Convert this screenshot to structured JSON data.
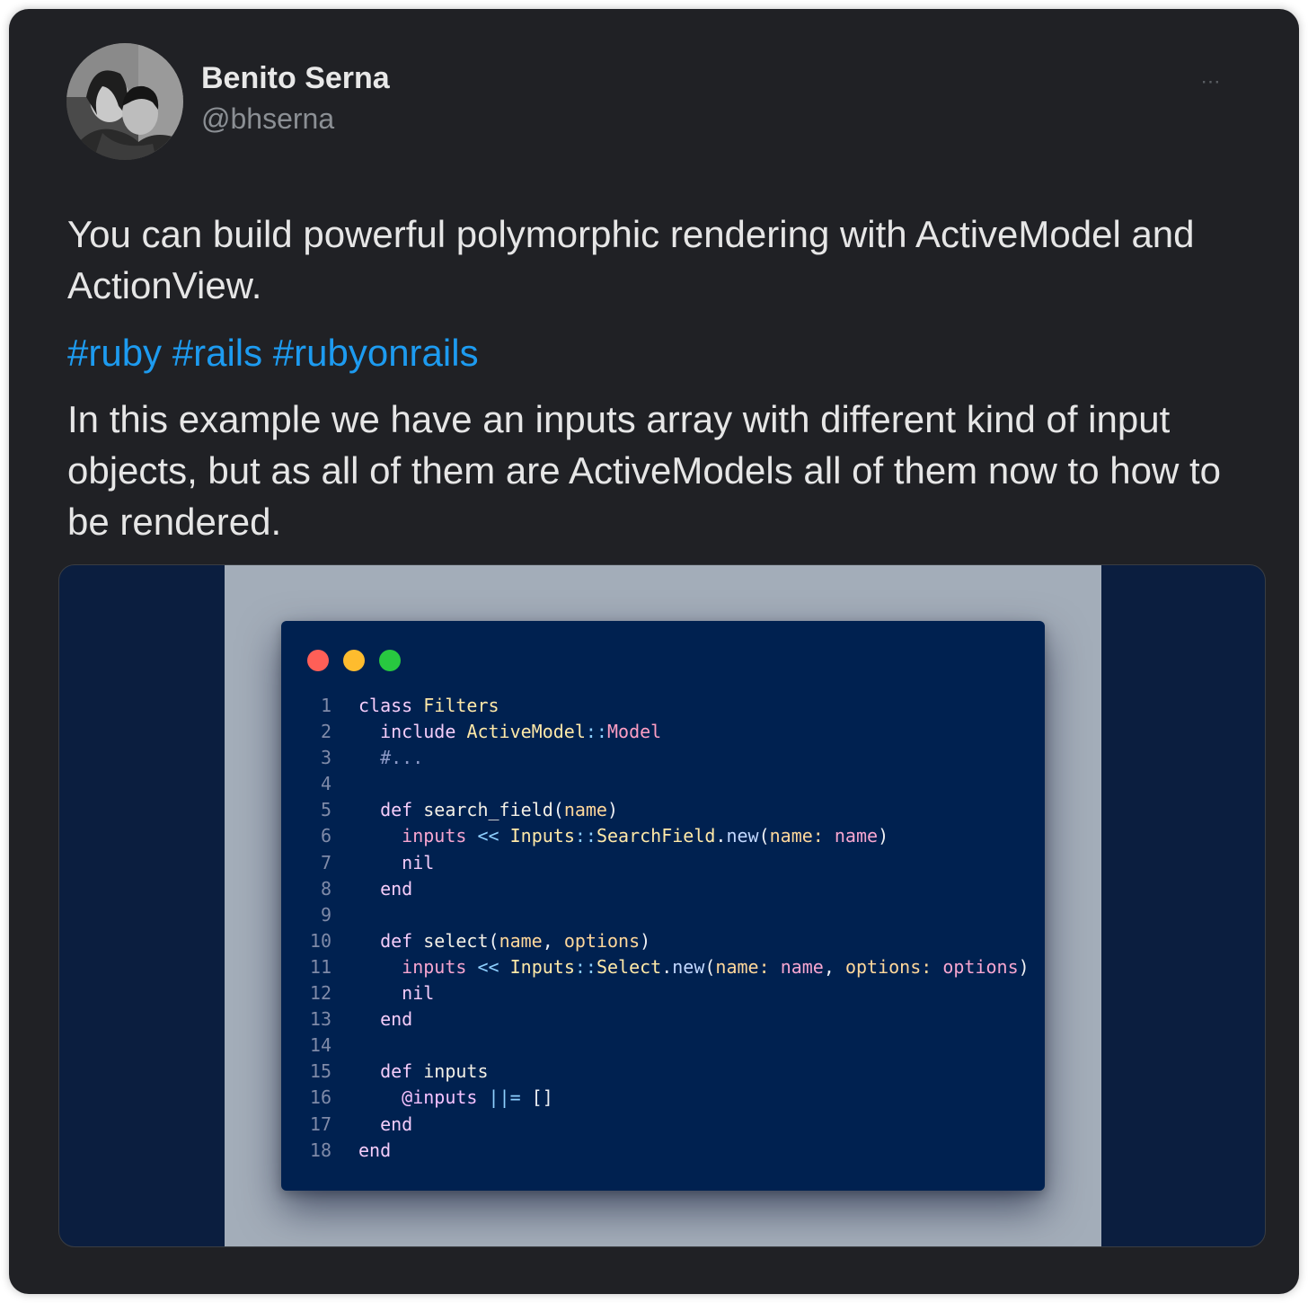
{
  "author": {
    "name": "Benito Serna",
    "handle": "@bhserna",
    "avatar_icon": "profile-photo"
  },
  "more_icon": "⋯",
  "tweet": {
    "paragraph1": "You can build powerful polymorphic rendering with ActiveModel and ActionView.",
    "hashtags": [
      "#ruby",
      "#rails",
      "#rubyonrails"
    ],
    "paragraph3": "In this example we have an inputs array with different kind of input objects, but as all of them are ActiveModels all of them now to how to be rendered."
  },
  "code": {
    "line_numbers": [
      "1",
      "2",
      "3",
      "4",
      "5",
      "6",
      "7",
      "8",
      "9",
      "10",
      "11",
      "12",
      "13",
      "14",
      "15",
      "16",
      "17",
      "18"
    ],
    "lines": [
      [
        [
          "kw",
          "class"
        ],
        [
          "p",
          " "
        ],
        [
          "cls",
          "Filters"
        ]
      ],
      [
        [
          "p",
          "  "
        ],
        [
          "kw",
          "include"
        ],
        [
          "p",
          " "
        ],
        [
          "cls",
          "ActiveModel"
        ],
        [
          "op",
          "::"
        ],
        [
          "mod",
          "Model"
        ]
      ],
      [
        [
          "p",
          "  "
        ],
        [
          "cm",
          "#..."
        ]
      ],
      [],
      [
        [
          "p",
          "  "
        ],
        [
          "kw",
          "def"
        ],
        [
          "p",
          " "
        ],
        [
          "def",
          "search_field"
        ],
        [
          "p",
          "("
        ],
        [
          "sym",
          "name"
        ],
        [
          "p",
          ")"
        ]
      ],
      [
        [
          "p",
          "    "
        ],
        [
          "var",
          "inputs"
        ],
        [
          "p",
          " "
        ],
        [
          "op",
          "<<"
        ],
        [
          "p",
          " "
        ],
        [
          "cls",
          "Inputs"
        ],
        [
          "op",
          "::"
        ],
        [
          "cls",
          "SearchField"
        ],
        [
          "p",
          "."
        ],
        [
          "call",
          "new"
        ],
        [
          "p",
          "("
        ],
        [
          "sym",
          "name:"
        ],
        [
          "p",
          " "
        ],
        [
          "var",
          "name"
        ],
        [
          "p",
          ")"
        ]
      ],
      [
        [
          "p",
          "    "
        ],
        [
          "kw",
          "nil"
        ]
      ],
      [
        [
          "p",
          "  "
        ],
        [
          "kw",
          "end"
        ]
      ],
      [],
      [
        [
          "p",
          "  "
        ],
        [
          "kw",
          "def"
        ],
        [
          "p",
          " "
        ],
        [
          "def",
          "select"
        ],
        [
          "p",
          "("
        ],
        [
          "sym",
          "name"
        ],
        [
          "p",
          ", "
        ],
        [
          "sym",
          "options"
        ],
        [
          "p",
          ")"
        ]
      ],
      [
        [
          "p",
          "    "
        ],
        [
          "var",
          "inputs"
        ],
        [
          "p",
          " "
        ],
        [
          "op",
          "<<"
        ],
        [
          "p",
          " "
        ],
        [
          "cls",
          "Inputs"
        ],
        [
          "op",
          "::"
        ],
        [
          "cls",
          "Select"
        ],
        [
          "p",
          "."
        ],
        [
          "call",
          "new"
        ],
        [
          "p",
          "("
        ],
        [
          "sym",
          "name:"
        ],
        [
          "p",
          " "
        ],
        [
          "var",
          "name"
        ],
        [
          "p",
          ", "
        ],
        [
          "sym",
          "options:"
        ],
        [
          "p",
          " "
        ],
        [
          "var",
          "options"
        ],
        [
          "p",
          ")"
        ]
      ],
      [
        [
          "p",
          "    "
        ],
        [
          "kw",
          "nil"
        ]
      ],
      [
        [
          "p",
          "  "
        ],
        [
          "kw",
          "end"
        ]
      ],
      [],
      [
        [
          "p",
          "  "
        ],
        [
          "kw",
          "def"
        ],
        [
          "p",
          " "
        ],
        [
          "def",
          "inputs"
        ]
      ],
      [
        [
          "p",
          "    "
        ],
        [
          "ivar",
          "@inputs"
        ],
        [
          "p",
          " "
        ],
        [
          "op",
          "||="
        ],
        [
          "p",
          " []"
        ]
      ],
      [
        [
          "p",
          "  "
        ],
        [
          "kw",
          "end"
        ]
      ],
      [
        [
          "kw",
          "end"
        ]
      ]
    ]
  },
  "colors": {
    "card_bg": "#202125",
    "hashtag": "#1d9bf0",
    "code_bg": "#002150",
    "frame_bg": "#a3adb9",
    "media_bg": "#0b1e3f"
  }
}
